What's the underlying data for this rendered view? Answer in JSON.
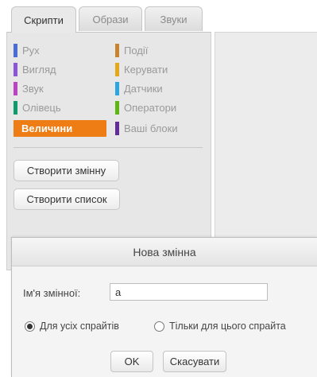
{
  "tabs": [
    {
      "label": "Скрипти",
      "active": true
    },
    {
      "label": "Образи",
      "active": false
    },
    {
      "label": "Звуки",
      "active": false
    }
  ],
  "palette": {
    "categories_left": [
      {
        "label": "Рух",
        "color": "#4a6cd4"
      },
      {
        "label": "Вигляд",
        "color": "#8a55d7"
      },
      {
        "label": "Звук",
        "color": "#bb42c3"
      },
      {
        "label": "Олівець",
        "color": "#0e9a6c"
      },
      {
        "label": "Величини",
        "color": "#ee7d16",
        "selected": true
      }
    ],
    "categories_right": [
      {
        "label": "Події",
        "color": "#c88330"
      },
      {
        "label": "Керувати",
        "color": "#e1a91a"
      },
      {
        "label": "Датчики",
        "color": "#2ca5e2"
      },
      {
        "label": "Оператори",
        "color": "#5cb712"
      },
      {
        "label": "Ваші блоки",
        "color": "#632d99"
      }
    ],
    "make_variable_label": "Створити змінну",
    "make_list_label": "Створити список"
  },
  "dialog": {
    "title": "Нова змінна",
    "name_label": "Ім'я змінної:",
    "name_value": "a",
    "radio_all_label": "Для усіх спрайтів",
    "radio_this_label": "Тільки для цього спрайта",
    "radio_selected": "all",
    "ok_label": "OK",
    "cancel_label": "Скасувати"
  }
}
